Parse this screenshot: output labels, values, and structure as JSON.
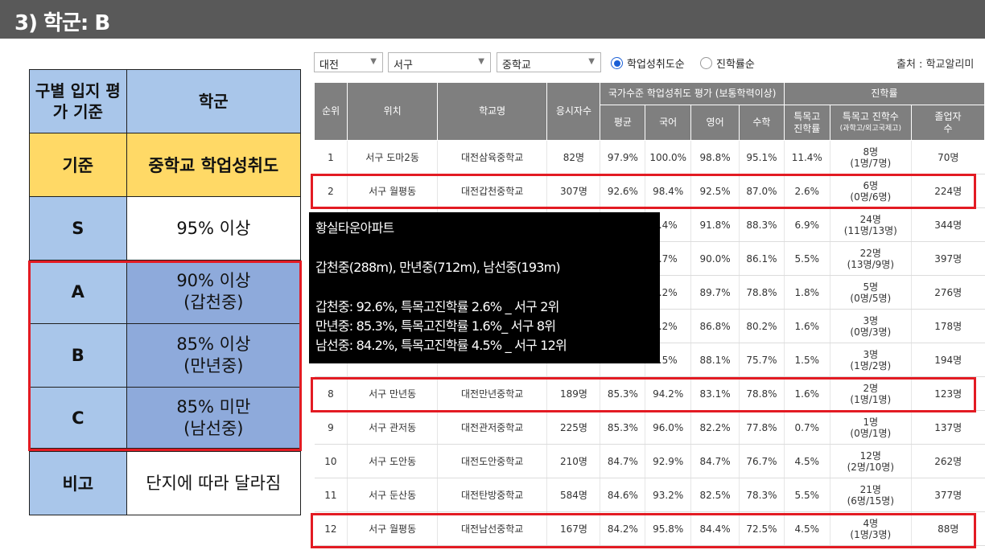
{
  "title": "3) 학군: B",
  "criteria": {
    "header_left": "구별 입지 평가 기준",
    "header_right": "학군",
    "basis_label": "기준",
    "basis_value": "중학교 학업성취도",
    "rows": [
      {
        "grade": "S",
        "line1": "95% 이상",
        "line2": ""
      },
      {
        "grade": "A",
        "line1": "90% 이상",
        "line2": "(갑천중)"
      },
      {
        "grade": "B",
        "line1": "85% 이상",
        "line2": "(만년중)"
      },
      {
        "grade": "C",
        "line1": "85% 미만",
        "line2": "(남선중)"
      }
    ],
    "note_label": "비고",
    "note_value": "단지에 따라 달라짐"
  },
  "filters": {
    "city": "대전",
    "district": "서구",
    "school_type": "중학교",
    "radio_achievement": "학업성취도순",
    "radio_advancement": "진학률순",
    "source": "출처 : 학교알리미"
  },
  "table": {
    "headers": {
      "rank": "순위",
      "location": "위치",
      "school": "학교명",
      "examinees": "응시자수",
      "national_group": "국가수준 학업성취도 평가 (보통학력이상)",
      "avg": "평균",
      "korean": "국어",
      "english": "영어",
      "math": "수학",
      "advance_group": "진학률",
      "special_rate_1": "특목고",
      "special_rate_2": "진학률",
      "special_count_1": "특목고 진학수",
      "special_count_2": "(과학고/외고국제고)",
      "grads_1": "졸업자",
      "grads_2": "수"
    },
    "rows": [
      {
        "rank": "1",
        "location": "서구 도마2동",
        "school": "대전삼육중학교",
        "examinees": "82명",
        "avg": "97.9%",
        "korean": "100.0%",
        "english": "98.8%",
        "math": "95.1%",
        "special_rate": "11.4%",
        "count": "8명",
        "count_detail": "(1명/7명)",
        "grads": "70명"
      },
      {
        "rank": "2",
        "location": "서구 월평동",
        "school": "대전갑천중학교",
        "examinees": "307명",
        "avg": "92.6%",
        "korean": "98.4%",
        "english": "92.5%",
        "math": "87.0%",
        "special_rate": "2.6%",
        "count": "6명",
        "count_detail": "(0명/6명)",
        "grads": "224명"
      },
      {
        "rank": "",
        "location": "",
        "school": "",
        "examinees": "",
        "avg": "",
        "korean": ".4%",
        "english": "91.8%",
        "math": "88.3%",
        "special_rate": "6.9%",
        "count": "24명",
        "count_detail": "(11명/13명)",
        "grads": "344명"
      },
      {
        "rank": "",
        "location": "",
        "school": "",
        "examinees": "",
        "avg": "",
        "korean": ".7%",
        "english": "90.0%",
        "math": "86.1%",
        "special_rate": "5.5%",
        "count": "22명",
        "count_detail": "(13명/9명)",
        "grads": "397명"
      },
      {
        "rank": "",
        "location": "",
        "school": "",
        "examinees": "",
        "avg": "",
        "korean": ".2%",
        "english": "89.7%",
        "math": "78.8%",
        "special_rate": "1.8%",
        "count": "5명",
        "count_detail": "(0명/5명)",
        "grads": "276명"
      },
      {
        "rank": "",
        "location": "",
        "school": "",
        "examinees": "",
        "avg": "",
        "korean": ".2%",
        "english": "86.8%",
        "math": "80.2%",
        "special_rate": "1.6%",
        "count": "3명",
        "count_detail": "(0명/3명)",
        "grads": "178명"
      },
      {
        "rank": "",
        "location": "",
        "school": "",
        "examinees": "",
        "avg": "",
        "korean": ".5%",
        "english": "88.1%",
        "math": "75.7%",
        "special_rate": "1.5%",
        "count": "3명",
        "count_detail": "(1명/2명)",
        "grads": "194명"
      },
      {
        "rank": "8",
        "location": "서구 만년동",
        "school": "대전만년중학교",
        "examinees": "189명",
        "avg": "85.3%",
        "korean": "94.2%",
        "english": "83.1%",
        "math": "78.8%",
        "special_rate": "1.6%",
        "count": "2명",
        "count_detail": "(1명/1명)",
        "grads": "123명"
      },
      {
        "rank": "9",
        "location": "서구 관저동",
        "school": "대전관저중학교",
        "examinees": "225명",
        "avg": "85.3%",
        "korean": "96.0%",
        "english": "82.2%",
        "math": "77.8%",
        "special_rate": "0.7%",
        "count": "1명",
        "count_detail": "(0명/1명)",
        "grads": "137명"
      },
      {
        "rank": "10",
        "location": "서구 도안동",
        "school": "대전도안중학교",
        "examinees": "210명",
        "avg": "84.7%",
        "korean": "92.9%",
        "english": "84.7%",
        "math": "76.7%",
        "special_rate": "4.5%",
        "count": "12명",
        "count_detail": "(2명/10명)",
        "grads": "262명"
      },
      {
        "rank": "11",
        "location": "서구 둔산동",
        "school": "대전탄방중학교",
        "examinees": "584명",
        "avg": "84.6%",
        "korean": "93.2%",
        "english": "82.5%",
        "math": "78.3%",
        "special_rate": "5.5%",
        "count": "21명",
        "count_detail": "(6명/15명)",
        "grads": "377명"
      },
      {
        "rank": "12",
        "location": "서구 월평동",
        "school": "대전남선중학교",
        "examinees": "167명",
        "avg": "84.2%",
        "korean": "95.8%",
        "english": "84.4%",
        "math": "72.5%",
        "special_rate": "4.5%",
        "count": "4명",
        "count_detail": "(1명/3명)",
        "grads": "88명"
      }
    ]
  },
  "tooltip": {
    "line1": "황실타운아파트",
    "line2": "갑천중(288m), 만년중(712m), 남선중(193m)",
    "line3": "갑천중: 92.6%, 특목고진학률 2.6% _ 서구 2위",
    "line4": "만년중: 85.3%, 특목고진학률 1.6%_ 서구 8위",
    "line5": "남선중: 84.2%, 특목고진학률 4.5% _ 서구 12위"
  },
  "colors": {
    "header_bar": "#595959",
    "light_blue": "#a9c6ea",
    "gold": "#ffd966",
    "dark_blue": "#8eaadb",
    "highlight_red": "#e31b23",
    "table_header": "#7f7f7f"
  }
}
